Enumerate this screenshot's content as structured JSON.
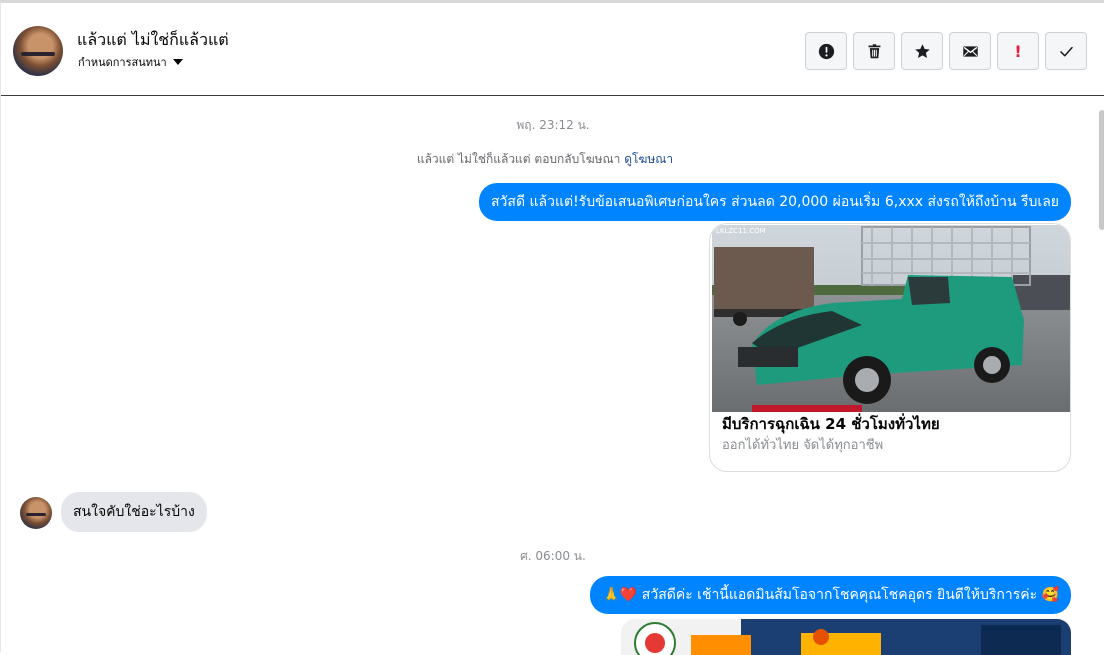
{
  "header": {
    "conversation_name": "แล้วแต่ ไม่ใช่ก็แล้วแต่",
    "assign_label": "กำหนดการสนทนา"
  },
  "actions": [
    {
      "name": "mark-spam",
      "icon": "alert-circle-icon"
    },
    {
      "name": "delete",
      "icon": "trash-icon"
    },
    {
      "name": "star",
      "icon": "star-icon"
    },
    {
      "name": "mark-unread",
      "icon": "envelope-icon"
    },
    {
      "name": "follow-up",
      "icon": "exclamation-icon",
      "glyph": "!"
    },
    {
      "name": "mark-done",
      "icon": "checkmark-icon"
    }
  ],
  "messages": {
    "time_1": "พฤ. 23:12 น.",
    "ad_notice_text": "แล้วแต่ ไม่ใช่ก็แล้วแต่ ตอบกลับโฆษณา",
    "ad_notice_link": "ดูโฆษณา",
    "outgoing_1": "สวัสดี แล้วแต่!รับข้อเสนอพิเศษก่อนใคร ส่วนลด 20,000 ผ่อนเริ่ม 6,xxx ส่งรถให้ถึงบ้าน รีบเลย",
    "ad_card": {
      "title": "มีบริการฉุกเฉิน 24 ชั่วโมงทั่วไทย",
      "subtitle": "ออกได้ทั่วไทย จัดได้ทุกอาชีพ",
      "image_overlay": "LKLZC11.COM"
    },
    "incoming_1": "สนใจคับใช่อะไรบ้าง",
    "time_2": "ศ. 06:00 น.",
    "outgoing_2": "🙏❤️ สวัสดีค่ะ เช้านี้แอดมินส้มโอจากโชคคุณโชคอุดร ยินดีให้บริการค่ะ 🥰"
  },
  "colors": {
    "bubble_out": "#0084ff",
    "bubble_in": "#e4e6eb",
    "link": "#1b4b96",
    "timestamp": "#8a8d91"
  }
}
